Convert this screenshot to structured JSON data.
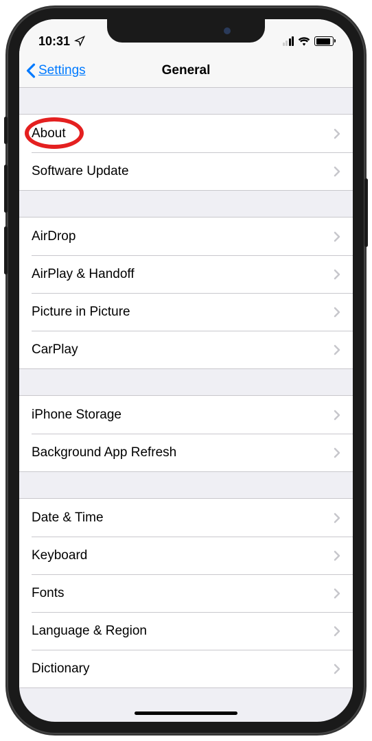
{
  "status_bar": {
    "time": "10:31"
  },
  "nav": {
    "back_label": "Settings",
    "title": "General"
  },
  "sections": [
    {
      "items": [
        {
          "label": "About",
          "highlighted": true
        },
        {
          "label": "Software Update"
        }
      ]
    },
    {
      "items": [
        {
          "label": "AirDrop"
        },
        {
          "label": "AirPlay & Handoff"
        },
        {
          "label": "Picture in Picture"
        },
        {
          "label": "CarPlay"
        }
      ]
    },
    {
      "items": [
        {
          "label": "iPhone Storage"
        },
        {
          "label": "Background App Refresh"
        }
      ]
    },
    {
      "items": [
        {
          "label": "Date & Time"
        },
        {
          "label": "Keyboard"
        },
        {
          "label": "Fonts"
        },
        {
          "label": "Language & Region"
        },
        {
          "label": "Dictionary"
        }
      ]
    }
  ]
}
